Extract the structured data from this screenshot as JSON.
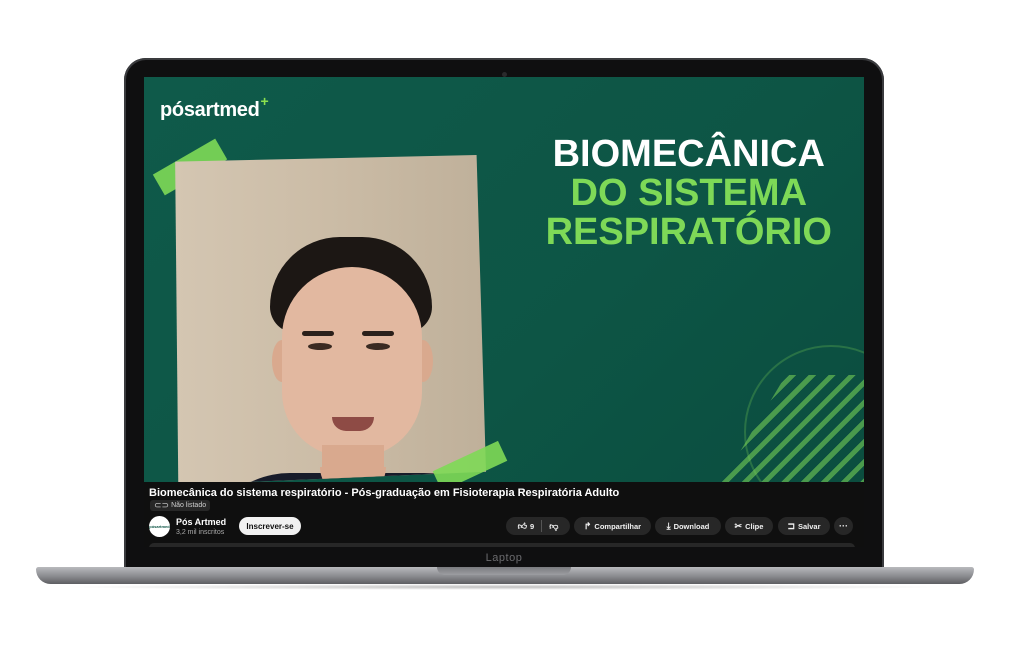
{
  "device": {
    "label": "Laptop"
  },
  "video": {
    "brand": "pósartmed",
    "brand_mark": "+",
    "headline": [
      "BIOMECÂNICA",
      "DO SISTEMA",
      "RESPIRATÓRIO"
    ]
  },
  "info": {
    "title": "Biomecânica do sistema respiratório - Pós-graduação em Fisioterapia Respiratória Adulto",
    "visibility": "Não listado",
    "channel": {
      "name": "Pós Artmed",
      "subscribers": "3,2 mil inscritos",
      "avatar_text": "pósartmed"
    },
    "subscribe_label": "Inscrever-se",
    "actions": {
      "like_count": "9",
      "share": "Compartilhar",
      "download": "Download",
      "clip": "Clipe",
      "save": "Salvar"
    }
  },
  "icons": {
    "like": "thumbs-up-icon",
    "dislike": "thumbs-down-icon",
    "share": "share-arrow-icon",
    "download": "download-icon",
    "clip": "scissors-icon",
    "save": "bookmark-icon",
    "more": "more-horizontal-icon",
    "visibility": "link-icon"
  },
  "colors": {
    "accent_green": "#7ed957",
    "background_green": "#0d5545",
    "player_dark": "#0f0f0f"
  }
}
